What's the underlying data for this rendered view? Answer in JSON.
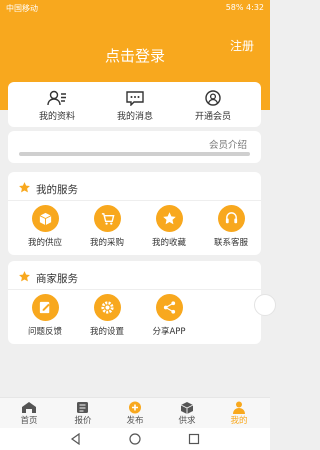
{
  "status": {
    "carrier": "中国移动",
    "battery": "58%",
    "time": "4:32"
  },
  "header": {
    "login": "点击登录",
    "register": "注册"
  },
  "quick": [
    {
      "label": "我的资料",
      "icon": "profile-icon"
    },
    {
      "label": "我的消息",
      "icon": "message-icon"
    },
    {
      "label": "开通会员",
      "icon": "member-icon"
    }
  ],
  "member_intro": "会员介绍",
  "services": {
    "title": "我的服务",
    "items": [
      {
        "label": "我的供应",
        "icon": "box-icon"
      },
      {
        "label": "我的采购",
        "icon": "cart-icon"
      },
      {
        "label": "我的收藏",
        "icon": "star-icon"
      },
      {
        "label": "联系客服",
        "icon": "headset-icon"
      }
    ]
  },
  "merchant": {
    "title": "商家服务",
    "items": [
      {
        "label": "问题反馈",
        "icon": "edit-icon"
      },
      {
        "label": "我的设置",
        "icon": "gear-icon"
      },
      {
        "label": "分享APP",
        "icon": "share-icon"
      }
    ]
  },
  "tabs": [
    {
      "label": "首页",
      "icon": "home-icon"
    },
    {
      "label": "报价",
      "icon": "quote-icon"
    },
    {
      "label": "发布",
      "icon": "plus-icon"
    },
    {
      "label": "供求",
      "icon": "cube-icon"
    },
    {
      "label": "我的",
      "icon": "person-icon"
    }
  ],
  "colors": {
    "accent": "#f8a81e",
    "background": "#efefef"
  }
}
